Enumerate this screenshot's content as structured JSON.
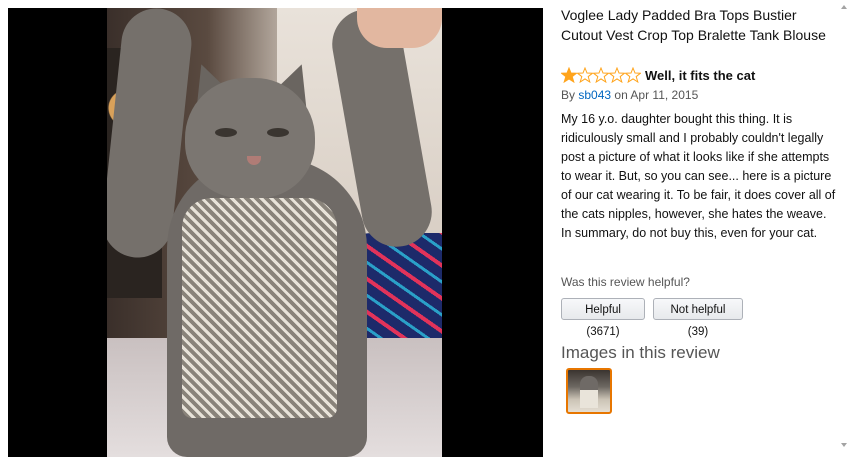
{
  "product": {
    "title": "Voglee Lady Padded Bra Tops Bustier Cutout Vest Crop Top Bralette Tank Blouse"
  },
  "review": {
    "rating": 1,
    "rating_max": 5,
    "star_color": "#ffa41c",
    "title": "Well, it fits the cat",
    "by_prefix": "By",
    "author": "sb043",
    "date": "on Apr 11, 2015",
    "body": "My 16 y.o. daughter bought this thing. It is ridiculously small and I probably couldn't legally post a picture of what it looks like if she attempts to wear it. But, so you can see... here is a picture of our cat wearing it. To be fair, it does cover all of the cats nipples, however, she hates the weave. In summary, do not buy this, even for your cat."
  },
  "helpful": {
    "question": "Was this review helpful?",
    "helpful_label": "Helpful (3671)",
    "not_helpful_label": "Not helpful (39)"
  },
  "images": {
    "heading": "Images in this review",
    "selected_border_color": "#e77600"
  },
  "colors": {
    "link": "#0066c0",
    "lightbox_bg": "#000000"
  }
}
